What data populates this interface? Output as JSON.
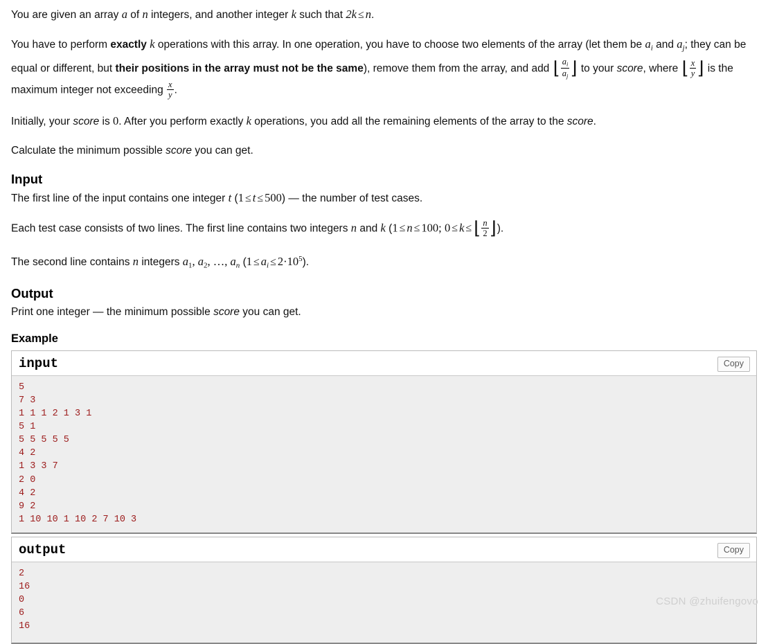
{
  "statement": {
    "p1": {
      "before_a": "You are given an array ",
      "var_a": "a",
      "mid1": " of ",
      "var_n": "n",
      "mid2": " integers, and another integer ",
      "var_k": "k",
      "mid3": " such that ",
      "cond": "2k",
      "le": "≤",
      "cond_rhs": "n",
      "end": "."
    },
    "p2": {
      "s1": "You have to perform ",
      "bold1": "exactly",
      "var_k": "k",
      "s2": " operations with this array. In one operation, you have to choose two elements of the array (let them be ",
      "var_ai": "a",
      "sub_i": "i",
      "s3": " and ",
      "var_aj": "a",
      "sub_j": "j",
      "s4": "; they can be equal or different, but ",
      "bold2": "their positions in the array must not be the same",
      "s5": "), remove them from the array, and add ",
      "frac1_num": "a",
      "frac1_num_sub": "i",
      "frac1_den": "a",
      "frac1_den_sub": "j",
      "s6": " to your ",
      "italic_score1": "score",
      "s7": ", where ",
      "frac2_num": "x",
      "frac2_den": "y",
      "s8": " is the maximum integer not exceeding ",
      "frac3_num": "x",
      "frac3_den": "y",
      "s9": "."
    },
    "p3": {
      "s1": "Initially, your ",
      "italic_score": "score",
      "s2": " is ",
      "zero": "0",
      "s3": ". After you perform exactly ",
      "var_k": "k",
      "s4": " operations, you add all the remaining elements of the array to the ",
      "italic_score2": "score",
      "s5": "."
    },
    "p4": {
      "s1": "Calculate the minimum possible ",
      "italic_score": "score",
      "s2": " you can get."
    }
  },
  "input_section": {
    "heading": "Input",
    "line1": {
      "s1": "The first line of the input contains one integer ",
      "var_t": "t",
      "s2": " (",
      "c1": "1",
      "le1": "≤",
      "c2": "t",
      "le2": "≤",
      "c3": "500",
      "s3": ") — the number of test cases."
    },
    "line2": {
      "s1": "Each test case consists of two lines. The first line contains two integers ",
      "var_n": "n",
      "s2": " and ",
      "var_k": "k",
      "s3": " (",
      "c1": "1",
      "le1": "≤",
      "c2": "n",
      "le2": "≤",
      "c3": "100",
      "semi": ";",
      "c4": "0",
      "le3": "≤",
      "c5": "k",
      "le4": "≤",
      "frac_num": "n",
      "frac_den": "2",
      "s4": ")."
    },
    "line3": {
      "s1": "The second line contains ",
      "var_n": "n",
      "s2": " integers ",
      "a1": "a",
      "a1sub": "1",
      "comma1": ", ",
      "a2": "a",
      "a2sub": "2",
      "comma2": ", ",
      "dots": "…",
      "comma3": ", ",
      "an": "a",
      "ansub": "n",
      "s3": " (",
      "c1": "1",
      "le1": "≤",
      "c2": "a",
      "c2sub": "i",
      "le2": "≤",
      "c3": "2",
      "dot": "·",
      "c4": "10",
      "c4sup": "5",
      "s4": ")."
    }
  },
  "output_section": {
    "heading": "Output",
    "line1": {
      "s1": "Print one integer — the minimum possible ",
      "italic_score": "score",
      "s2": " you can get."
    }
  },
  "example": {
    "heading": "Example",
    "copy_label": "Copy",
    "input": {
      "title": "input",
      "content": "5\n7 3\n1 1 1 2 1 3 1\n5 1\n5 5 5 5 5\n4 2\n1 3 3 7\n2 0\n4 2\n9 2\n1 10 10 1 10 2 7 10 3"
    },
    "output": {
      "title": "output",
      "content": "2\n16\n0\n6\n16"
    }
  },
  "watermark": {
    "text": "CSDN @zhuifengovo"
  },
  "colors": {
    "code_text": "#9c1b1b",
    "code_bg": "#eeeeee",
    "block_border": "#bbbbbb",
    "watermark": "#cfcfcf"
  }
}
